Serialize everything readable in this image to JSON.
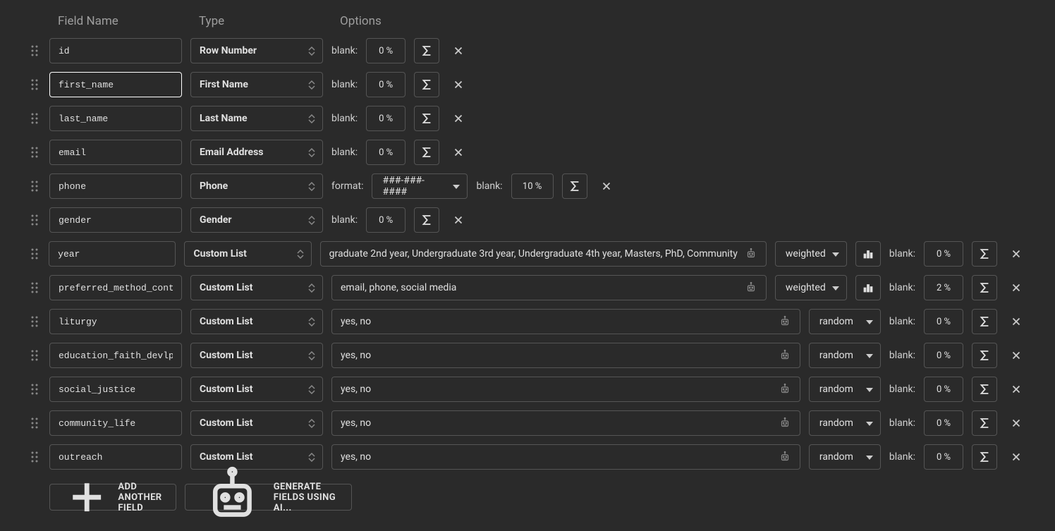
{
  "headers": {
    "fieldName": "Field Name",
    "type": "Type",
    "options": "Options"
  },
  "labels": {
    "blank": "blank:",
    "format": "format:"
  },
  "dist": {
    "weighted": "weighted",
    "random": "random"
  },
  "rows": [
    {
      "name": "id",
      "type": "Row Number",
      "kind": "simple",
      "blank": "0 %",
      "active": false
    },
    {
      "name": "first_name",
      "type": "First Name",
      "kind": "simple",
      "blank": "0 %",
      "active": true
    },
    {
      "name": "last_name",
      "type": "Last Name",
      "kind": "simple",
      "blank": "0 %",
      "active": false
    },
    {
      "name": "email",
      "type": "Email Address",
      "kind": "simple",
      "blank": "0 %",
      "active": false
    },
    {
      "name": "phone",
      "type": "Phone",
      "kind": "format",
      "format": "###-###-####",
      "blank": "10 %",
      "active": false
    },
    {
      "name": "gender",
      "type": "Gender",
      "kind": "simple",
      "blank": "0 %",
      "active": false
    },
    {
      "name": "year",
      "type": "Custom List",
      "kind": "custom",
      "list": "graduate 2nd year, Undergraduate 3rd year, Undergraduate 4th year, Masters, PhD, Community",
      "dist": "weighted",
      "chart": true,
      "blank": "0 %",
      "active": false
    },
    {
      "name": "preferred_method_contact",
      "type": "Custom List",
      "kind": "custom",
      "list": "email, phone, social media",
      "dist": "weighted",
      "chart": true,
      "blank": "2 %",
      "active": false
    },
    {
      "name": "liturgy",
      "type": "Custom List",
      "kind": "custom",
      "list": "yes, no",
      "dist": "random",
      "chart": false,
      "blank": "0 %",
      "active": false
    },
    {
      "name": "education_faith_devlpmt",
      "type": "Custom List",
      "kind": "custom",
      "list": "yes, no",
      "dist": "random",
      "chart": false,
      "blank": "0 %",
      "active": false
    },
    {
      "name": "social_justice",
      "type": "Custom List",
      "kind": "custom",
      "list": "yes, no",
      "dist": "random",
      "chart": false,
      "blank": "0 %",
      "active": false
    },
    {
      "name": "community_life",
      "type": "Custom List",
      "kind": "custom",
      "list": "yes, no",
      "dist": "random",
      "chart": false,
      "blank": "0 %",
      "active": false
    },
    {
      "name": "outreach",
      "type": "Custom List",
      "kind": "custom",
      "list": "yes, no",
      "dist": "random",
      "chart": false,
      "blank": "0 %",
      "active": false
    }
  ],
  "footer": {
    "add": "ADD ANOTHER FIELD",
    "ai": "GENERATE FIELDS USING AI..."
  }
}
